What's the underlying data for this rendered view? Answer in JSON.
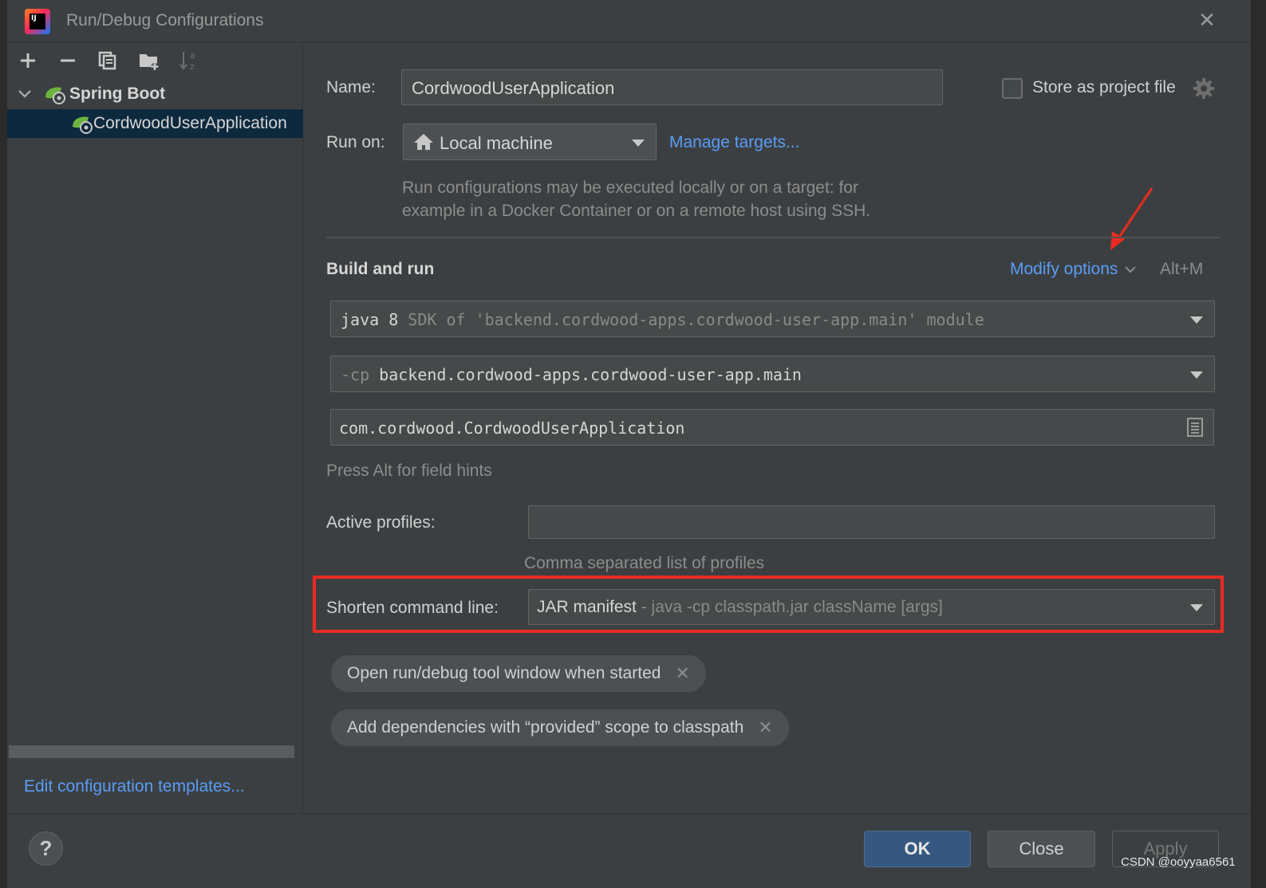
{
  "window": {
    "title": "Run/Debug Configurations",
    "app_icon_text": "IJ"
  },
  "toolbar": {
    "add": "+",
    "remove": "−",
    "sort_label": "↓a z"
  },
  "tree": {
    "group_label": "Spring Boot",
    "item_label": "CordwoodUserApplication"
  },
  "left_footer": {
    "edit_templates_link": "Edit configuration templates..."
  },
  "form": {
    "name_label": "Name:",
    "name_value": "CordwoodUserApplication",
    "store_label": "Store as project file",
    "store_checked": false,
    "run_on_label": "Run on:",
    "run_on_value": "Local machine",
    "manage_targets_link": "Manage targets...",
    "run_on_hint_line1": "Run configurations may be executed locally or on a target: for",
    "run_on_hint_line2": "example in a Docker Container or on a remote host using SSH.",
    "build_run_heading": "Build and run",
    "modify_options_link": "Modify options",
    "modify_options_shortcut": "Alt+M",
    "jre_main": "java 8",
    "jre_detail": "SDK of 'backend.cordwood-apps.cordwood-user-app.main' module",
    "cp_prefix": "-cp",
    "cp_value": "backend.cordwood-apps.cordwood-user-app.main",
    "main_class": "com.cordwood.CordwoodUserApplication",
    "field_hints": "Press Alt for field hints",
    "active_profiles_label": "Active profiles:",
    "active_profiles_value": "",
    "active_profiles_hint": "Comma separated list of profiles",
    "shorten_label": "Shorten command line:",
    "shorten_value": "JAR manifest",
    "shorten_detail": "- java -cp classpath.jar className [args]",
    "chips": [
      "Open run/debug tool window when started",
      "Add dependencies with “provided” scope to classpath"
    ]
  },
  "buttons": {
    "help": "?",
    "ok": "OK",
    "close": "Close",
    "apply": "Apply"
  },
  "watermark": "CSDN @ooyyaa6561",
  "colors": {
    "accent_link": "#589df6",
    "highlight_box": "#ea2b22",
    "selection": "#0d293e",
    "ok_button": "#365880"
  }
}
